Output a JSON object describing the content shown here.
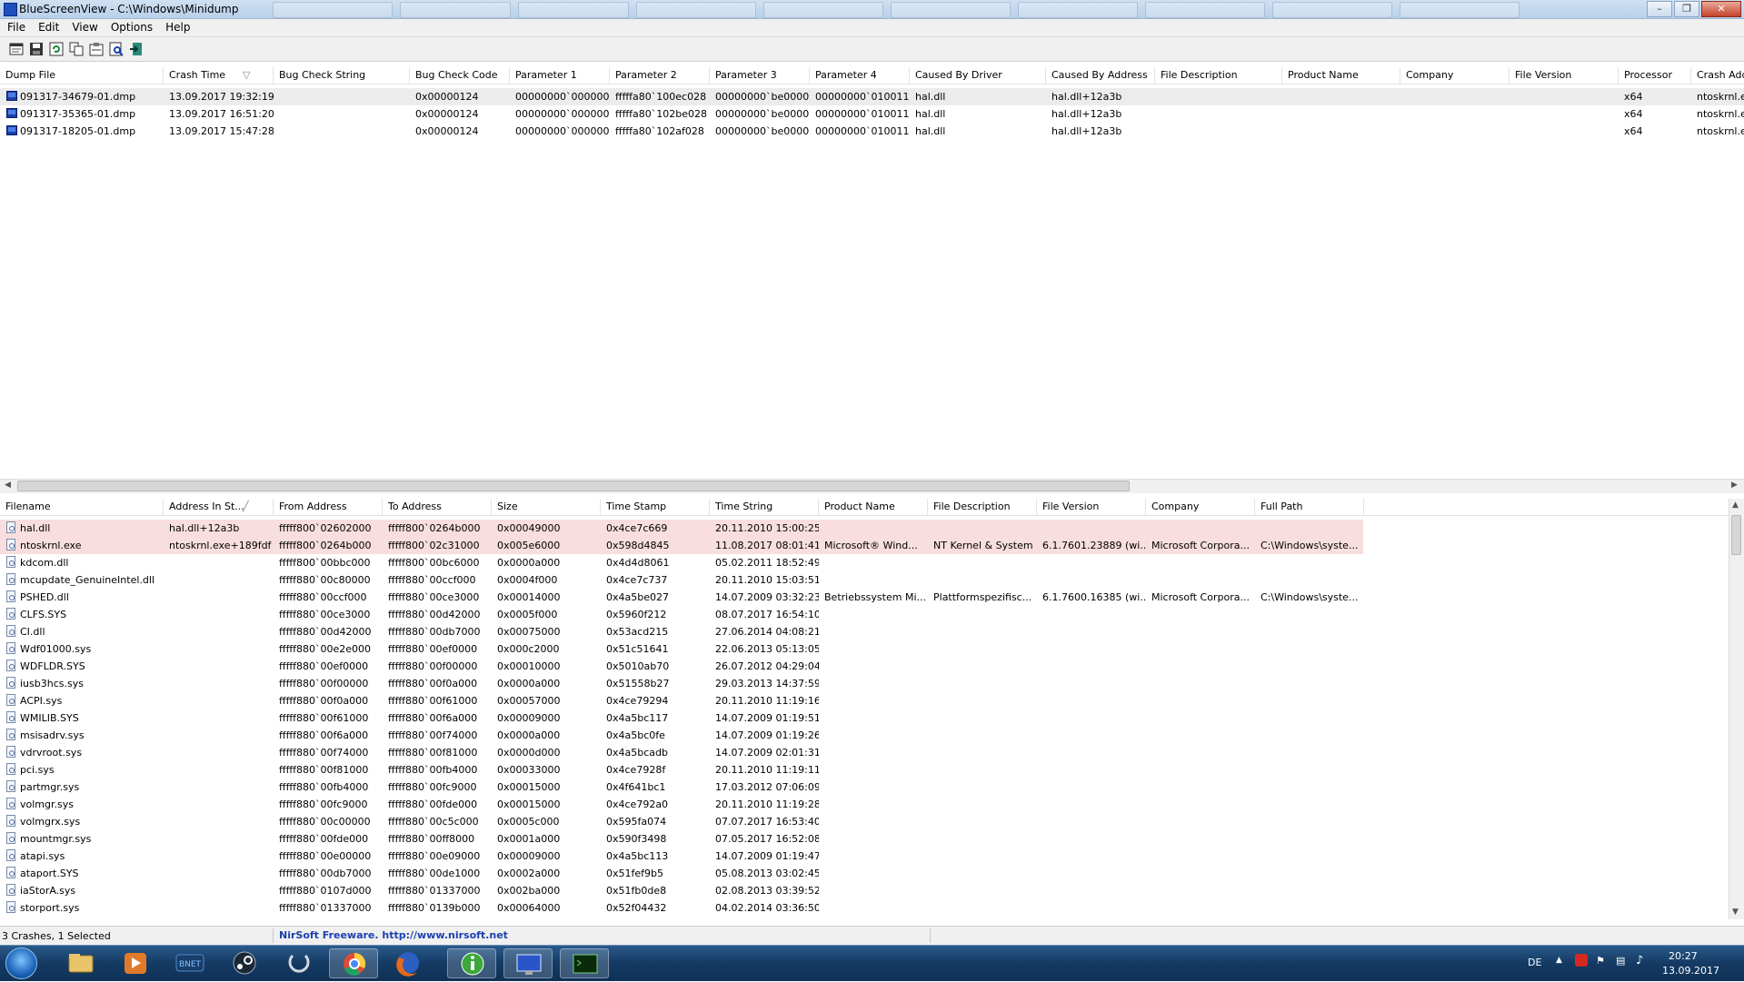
{
  "window": {
    "title": "BlueScreenView  -  C:\\Windows\\Minidump",
    "min_icon": "minimize-icon",
    "max_icon": "maximize-icon",
    "close_icon": "close-icon"
  },
  "menu": [
    "File",
    "Edit",
    "View",
    "Options",
    "Help"
  ],
  "toolbar_icons": [
    "html-report-icon",
    "save-icon",
    "refresh-icon",
    "copy-icon",
    "properties-icon",
    "advanced-options-icon",
    "exit-icon"
  ],
  "dump_list": {
    "columns": [
      "Dump File",
      "Crash Time",
      "Bug Check String",
      "Bug Check Code",
      "Parameter 1",
      "Parameter 2",
      "Parameter 3",
      "Parameter 4",
      "Caused By Driver",
      "Caused By Address",
      "File Description",
      "Product Name",
      "Company",
      "File Version",
      "Processor",
      "Crash Add"
    ],
    "rows": [
      [
        "091317-34679-01.dmp",
        "13.09.2017 19:32:19",
        "",
        "0x00000124",
        "00000000`000000...",
        "fffffa80`100ec028",
        "00000000`be0000...",
        "00000000`010011...",
        "hal.dll",
        "hal.dll+12a3b",
        "",
        "",
        "",
        "",
        "x64",
        "ntoskrnl.e"
      ],
      [
        "091317-35365-01.dmp",
        "13.09.2017 16:51:20",
        "",
        "0x00000124",
        "00000000`000000...",
        "fffffa80`102be028",
        "00000000`be0000...",
        "00000000`010011...",
        "hal.dll",
        "hal.dll+12a3b",
        "",
        "",
        "",
        "",
        "x64",
        "ntoskrnl.e"
      ],
      [
        "091317-18205-01.dmp",
        "13.09.2017 15:47:28",
        "",
        "0x00000124",
        "00000000`000000...",
        "fffffa80`102af028",
        "00000000`be0000...",
        "00000000`010011...",
        "hal.dll",
        "hal.dll+12a3b",
        "",
        "",
        "",
        "",
        "x64",
        "ntoskrnl.e"
      ]
    ]
  },
  "driver_list": {
    "columns": [
      "Filename",
      "Address In St...",
      "From Address",
      "To Address",
      "Size",
      "Time Stamp",
      "Time String",
      "Product Name",
      "File Description",
      "File Version",
      "Company",
      "Full Path"
    ],
    "rows": [
      [
        "hal.dll",
        "hal.dll+12a3b",
        "fffff800`02602000",
        "fffff800`0264b000",
        "0x00049000",
        "0x4ce7c669",
        "20.11.2010 15:00:25",
        "",
        "",
        "",
        "",
        ""
      ],
      [
        "ntoskrnl.exe",
        "ntoskrnl.exe+189fdf",
        "fffff800`0264b000",
        "fffff800`02c31000",
        "0x005e6000",
        "0x598d4845",
        "11.08.2017 08:01:41",
        "Microsoft® Wind...",
        "NT Kernel & System",
        "6.1.7601.23889 (wi...",
        "Microsoft Corpora...",
        "C:\\Windows\\syste..."
      ],
      [
        "kdcom.dll",
        "",
        "fffff800`00bbc000",
        "fffff800`00bc6000",
        "0x0000a000",
        "0x4d4d8061",
        "05.02.2011 18:52:49",
        "",
        "",
        "",
        "",
        ""
      ],
      [
        "mcupdate_GenuineIntel.dll",
        "",
        "fffff880`00c80000",
        "fffff880`00ccf000",
        "0x0004f000",
        "0x4ce7c737",
        "20.11.2010 15:03:51",
        "",
        "",
        "",
        "",
        ""
      ],
      [
        "PSHED.dll",
        "",
        "fffff880`00ccf000",
        "fffff880`00ce3000",
        "0x00014000",
        "0x4a5be027",
        "14.07.2009 03:32:23",
        "Betriebssystem Mi...",
        "Plattformspezifisc...",
        "6.1.7600.16385 (wi...",
        "Microsoft Corpora...",
        "C:\\Windows\\syste..."
      ],
      [
        "CLFS.SYS",
        "",
        "fffff880`00ce3000",
        "fffff880`00d42000",
        "0x0005f000",
        "0x5960f212",
        "08.07.2017 16:54:10",
        "",
        "",
        "",
        "",
        ""
      ],
      [
        "CI.dll",
        "",
        "fffff880`00d42000",
        "fffff880`00db7000",
        "0x00075000",
        "0x53acd215",
        "27.06.2014 04:08:21",
        "",
        "",
        "",
        "",
        ""
      ],
      [
        "Wdf01000.sys",
        "",
        "fffff880`00e2e000",
        "fffff880`00ef0000",
        "0x000c2000",
        "0x51c51641",
        "22.06.2013 05:13:05",
        "",
        "",
        "",
        "",
        ""
      ],
      [
        "WDFLDR.SYS",
        "",
        "fffff880`00ef0000",
        "fffff880`00f00000",
        "0x00010000",
        "0x5010ab70",
        "26.07.2012 04:29:04",
        "",
        "",
        "",
        "",
        ""
      ],
      [
        "iusb3hcs.sys",
        "",
        "fffff880`00f00000",
        "fffff880`00f0a000",
        "0x0000a000",
        "0x51558b27",
        "29.03.2013 14:37:59",
        "",
        "",
        "",
        "",
        ""
      ],
      [
        "ACPI.sys",
        "",
        "fffff880`00f0a000",
        "fffff880`00f61000",
        "0x00057000",
        "0x4ce79294",
        "20.11.2010 11:19:16",
        "",
        "",
        "",
        "",
        ""
      ],
      [
        "WMILIB.SYS",
        "",
        "fffff880`00f61000",
        "fffff880`00f6a000",
        "0x00009000",
        "0x4a5bc117",
        "14.07.2009 01:19:51",
        "",
        "",
        "",
        "",
        ""
      ],
      [
        "msisadrv.sys",
        "",
        "fffff880`00f6a000",
        "fffff880`00f74000",
        "0x0000a000",
        "0x4a5bc0fe",
        "14.07.2009 01:19:26",
        "",
        "",
        "",
        "",
        ""
      ],
      [
        "vdrvroot.sys",
        "",
        "fffff880`00f74000",
        "fffff880`00f81000",
        "0x0000d000",
        "0x4a5bcadb",
        "14.07.2009 02:01:31",
        "",
        "",
        "",
        "",
        ""
      ],
      [
        "pci.sys",
        "",
        "fffff880`00f81000",
        "fffff880`00fb4000",
        "0x00033000",
        "0x4ce7928f",
        "20.11.2010 11:19:11",
        "",
        "",
        "",
        "",
        ""
      ],
      [
        "partmgr.sys",
        "",
        "fffff880`00fb4000",
        "fffff880`00fc9000",
        "0x00015000",
        "0x4f641bc1",
        "17.03.2012 07:06:09",
        "",
        "",
        "",
        "",
        ""
      ],
      [
        "volmgr.sys",
        "",
        "fffff880`00fc9000",
        "fffff880`00fde000",
        "0x00015000",
        "0x4ce792a0",
        "20.11.2010 11:19:28",
        "",
        "",
        "",
        "",
        ""
      ],
      [
        "volmgrx.sys",
        "",
        "fffff880`00c00000",
        "fffff880`00c5c000",
        "0x0005c000",
        "0x595fa074",
        "07.07.2017 16:53:40",
        "",
        "",
        "",
        "",
        ""
      ],
      [
        "mountmgr.sys",
        "",
        "fffff880`00fde000",
        "fffff880`00ff8000",
        "0x0001a000",
        "0x590f3498",
        "07.05.2017 16:52:08",
        "",
        "",
        "",
        "",
        ""
      ],
      [
        "atapi.sys",
        "",
        "fffff880`00e00000",
        "fffff880`00e09000",
        "0x00009000",
        "0x4a5bc113",
        "14.07.2009 01:19:47",
        "",
        "",
        "",
        "",
        ""
      ],
      [
        "ataport.SYS",
        "",
        "fffff880`00db7000",
        "fffff880`00de1000",
        "0x0002a000",
        "0x51fef9b5",
        "05.08.2013 03:02:45",
        "",
        "",
        "",
        "",
        ""
      ],
      [
        "iaStorA.sys",
        "",
        "fffff880`0107d000",
        "fffff880`01337000",
        "0x002ba000",
        "0x51fb0de8",
        "02.08.2013 03:39:52",
        "",
        "",
        "",
        "",
        ""
      ],
      [
        "storport.sys",
        "",
        "fffff880`01337000",
        "fffff880`0139b000",
        "0x00064000",
        "0x52f04432",
        "04.02.2014 03:36:50",
        "",
        "",
        "",
        "",
        ""
      ]
    ]
  },
  "statusbar": {
    "left": "3 Crashes, 1 Selected",
    "center": "NirSoft Freeware.  http://www.nirsoft.net"
  },
  "taskbar": {
    "buttons": [
      "start-icon",
      "explorer-icon",
      "media-player-icon",
      "battlenet-icon",
      "steam-icon",
      "app-icon",
      "chrome-icon",
      "firefox-icon",
      "info-app-icon",
      "bluescreenview-icon",
      "terminal-icon"
    ],
    "lang": "DE",
    "time": "20:27",
    "date": "13.09.2017"
  },
  "colors": {
    "highlight_row": "#f8dede",
    "selected_row": "#ececec",
    "link_blue": "#1c3fb0"
  }
}
